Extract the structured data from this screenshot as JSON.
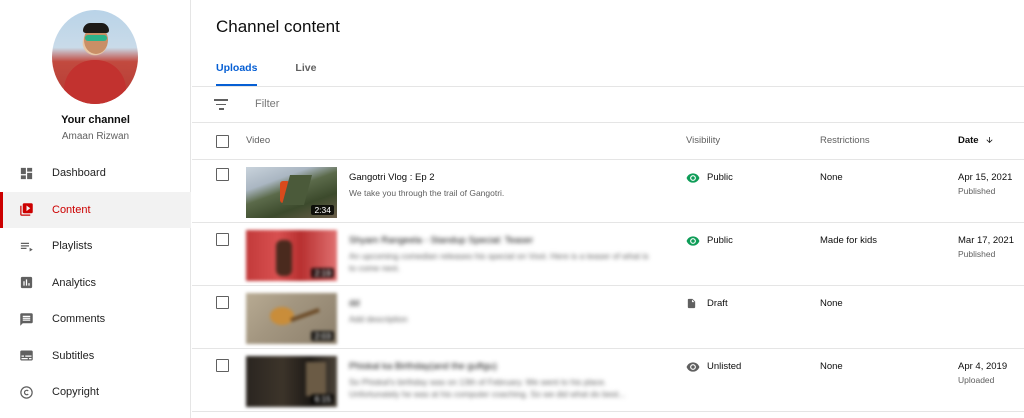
{
  "sidebar": {
    "channel_title": "Your channel",
    "channel_name": "Amaan Rizwan",
    "items": [
      {
        "label": "Dashboard",
        "icon": "dashboard-icon",
        "active": false
      },
      {
        "label": "Content",
        "icon": "content-icon",
        "active": true
      },
      {
        "label": "Playlists",
        "icon": "playlists-icon",
        "active": false
      },
      {
        "label": "Analytics",
        "icon": "analytics-icon",
        "active": false
      },
      {
        "label": "Comments",
        "icon": "comments-icon",
        "active": false
      },
      {
        "label": "Subtitles",
        "icon": "subtitles-icon",
        "active": false
      },
      {
        "label": "Copyright",
        "icon": "copyright-icon",
        "active": false
      }
    ]
  },
  "main": {
    "title": "Channel content",
    "tabs": [
      {
        "label": "Uploads",
        "active": true
      },
      {
        "label": "Live",
        "active": false
      }
    ],
    "filter_placeholder": "Filter",
    "columns": {
      "video": "Video",
      "visibility": "Visibility",
      "restrictions": "Restrictions",
      "date": "Date",
      "date_sort_icon": "arrow-down-icon"
    },
    "rows": [
      {
        "title": "Gangotri Vlog : Ep 2",
        "description": "We take you through the trail of Gangotri.",
        "duration": "2:34",
        "visibility": "Public",
        "visibility_icon": "eye-icon",
        "restrictions": "None",
        "date": "Apr 15, 2021",
        "date_status": "Published",
        "blurred": false
      },
      {
        "title": "Shyam Rangeela - Standup Special: Teaser",
        "description": "An upcoming comedian releases his special on Voot. Here is a teaser of what is to come next.",
        "duration": "2:19",
        "visibility": "Public",
        "visibility_icon": "eye-icon",
        "restrictions": "Made for kids",
        "date": "Mar 17, 2021",
        "date_status": "Published",
        "blurred": true
      },
      {
        "title": "dd",
        "description": "Add description",
        "duration": "2:03",
        "visibility": "Draft",
        "visibility_icon": "draft-file-icon",
        "restrictions": "None",
        "date": "",
        "date_status": "",
        "blurred": true
      },
      {
        "title": "Phiskal ka Birthday(and the guftgu)",
        "description": "So Phiskal's birthday was on 13th of February. We went to his place. Unfortunately he was at his computer coaching. So we did what do best...",
        "duration": "6:15",
        "visibility": "Unlisted",
        "visibility_icon": "eye-icon",
        "restrictions": "None",
        "date": "Apr 4, 2019",
        "date_status": "Uploaded",
        "blurred": true
      }
    ]
  },
  "colors": {
    "accent_red": "#cc0000",
    "tab_blue": "#065fd4",
    "public_green": "#0f9d58",
    "divider": "#e5e5e5"
  }
}
